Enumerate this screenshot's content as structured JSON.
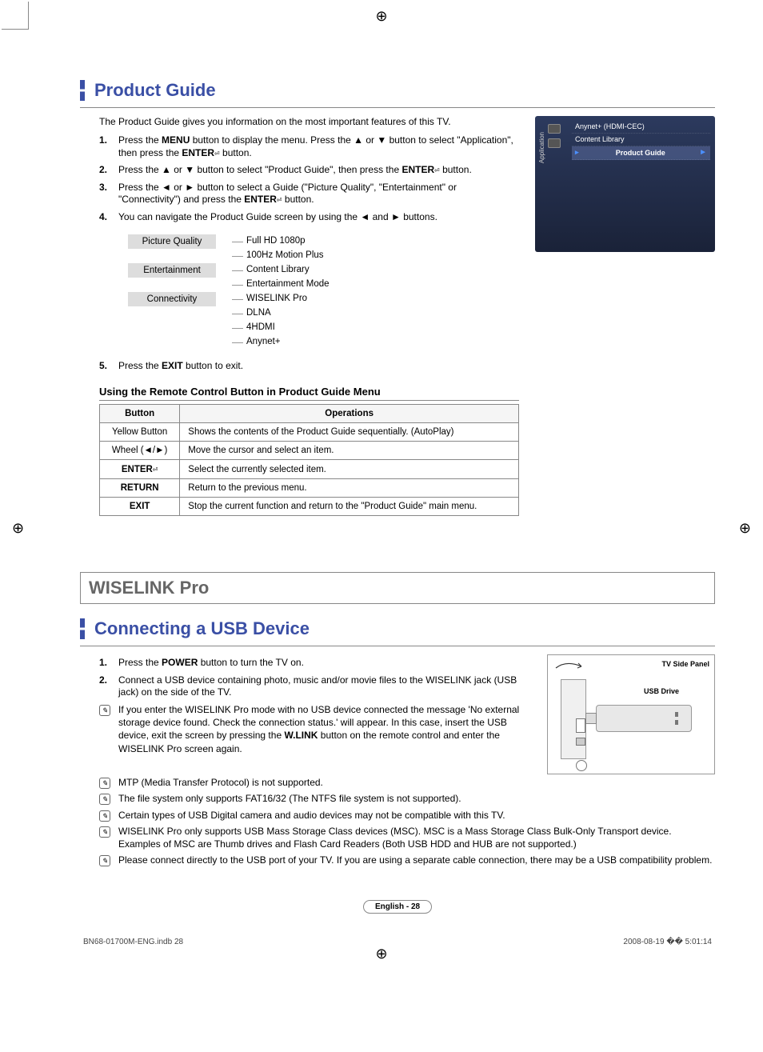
{
  "section1": {
    "title": "Product Guide",
    "intro": "The Product Guide gives you information on the most important features of this TV.",
    "steps": [
      "Press the <b>MENU</b> button to display the menu. Press the ▲ or ▼ button to select \"Application\", then press the <b>ENTER</b><span class='enter-glyph'>⏎</span> button.",
      "Press the ▲ or ▼ button to select \"Product Guide\", then press the <b>ENTER</b><span class='enter-glyph'>⏎</span> button.",
      "Press the ◄ or ► button to select a Guide (\"Picture Quality\", \"Entertainment\" or \"Connectivity\") and press the <b>ENTER</b><span class='enter-glyph'>⏎</span> button.",
      "You can navigate the Product Guide screen by using the ◄ and ► buttons."
    ],
    "tree": [
      {
        "cat": "Picture Quality",
        "items": [
          "Full HD 1080p",
          "100Hz Motion Plus"
        ]
      },
      {
        "cat": "Entertainment",
        "items": [
          "Content Library",
          "Entertainment Mode"
        ]
      },
      {
        "cat": "Connectivity",
        "items": [
          "WISELINK Pro",
          "DLNA",
          "4HDMI",
          "Anynet+"
        ]
      }
    ],
    "step5": "Press the <b>EXIT</b> button to exit.",
    "subhead": "Using the Remote Control Button in Product Guide Menu",
    "table": {
      "headers": [
        "Button",
        "Operations"
      ],
      "rows": [
        [
          "Yellow Button",
          "Shows the contents of the Product Guide sequentially. (AutoPlay)"
        ],
        [
          "Wheel (<span class='wheel-arrows'>◄/►</span>)",
          "Move the cursor and select an item."
        ],
        [
          "<b>ENTER</b><span class='enter-glyph'>⏎</span>",
          "Select the currently selected item."
        ],
        [
          "<b>RETURN</b>",
          "Return to the previous menu."
        ],
        [
          "<b>EXIT</b>",
          "Stop the current function and return to the \"Product Guide\" main menu."
        ]
      ]
    }
  },
  "tvmenu": {
    "side": "Application",
    "items": [
      {
        "label": "Anynet+ (HDMI-CEC)",
        "sel": false
      },
      {
        "label": "Content Library",
        "sel": false
      },
      {
        "label": "Product Guide",
        "sel": true
      }
    ]
  },
  "section2": {
    "bar_title": "WISELINK Pro",
    "title": "Connecting a USB Device",
    "steps": [
      "Press the <b>POWER</b> button to turn the TV on.",
      "Connect a USB device containing photo, music and/or movie files to the WISELINK jack (USB jack) on the side of the TV."
    ],
    "notes": [
      "If you enter the WISELINK Pro mode with no USB device connected the message 'No external storage device found. Check the connection status.' will appear. In this case, insert the USB device, exit the screen by pressing the <b>W.LINK</b> button on the remote control and enter the WISELINK Pro screen again.",
      "MTP (Media Transfer Protocol) is not supported.",
      "The file system only supports FAT16/32 (The NTFS file system is not supported).",
      "Certain types of USB Digital camera and audio devices may not be compatible with this TV.",
      "WISELINK Pro only supports USB Mass Storage Class devices (MSC). MSC is a Mass Storage Class Bulk-Only Transport device. Examples of MSC are Thumb drives and Flash Card Readers (Both USB HDD and HUB are not supported.)",
      "Please connect directly to the USB port of your TV. If you are using a separate cable connection, there may be a USB compatibility problem."
    ],
    "usb_labels": {
      "panel": "TV Side Panel",
      "drive": "USB Drive"
    }
  },
  "footer": {
    "page": "English - 28",
    "left": "BN68-01700M-ENG.indb   28",
    "right": "2008-08-19   �� 5:01:14"
  }
}
